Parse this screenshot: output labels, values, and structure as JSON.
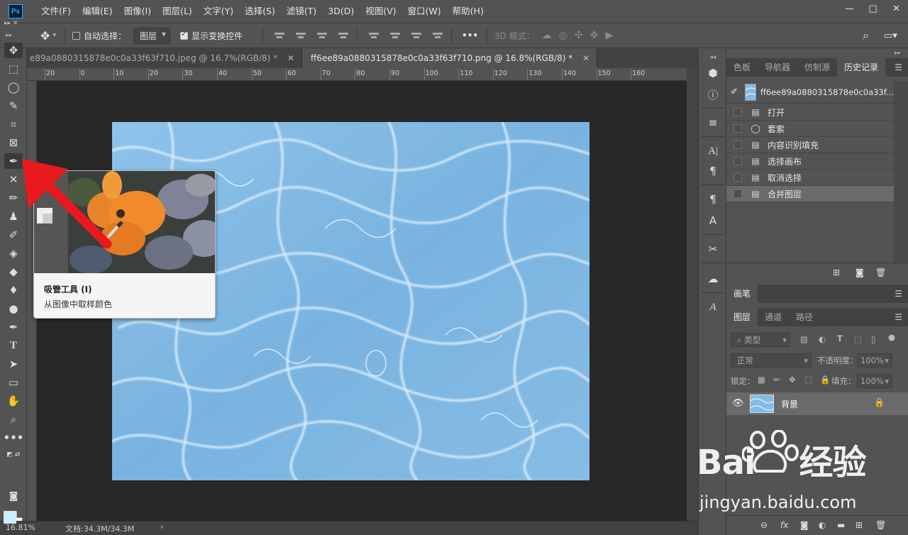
{
  "app": {
    "logo": "Ps"
  },
  "menu": [
    "文件(F)",
    "编辑(E)",
    "图像(I)",
    "图层(L)",
    "文字(Y)",
    "选择(S)",
    "滤镜(T)",
    "3D(D)",
    "视图(V)",
    "窗口(W)",
    "帮助(H)"
  ],
  "window_controls": {
    "minimize": "—",
    "restore": "□",
    "close": "✕"
  },
  "options": {
    "auto_select_label": "自动选择：",
    "auto_select_value": "图层",
    "show_transform_label": "显示变换控件",
    "more": "•••",
    "mode_3d_label": "3D 模式："
  },
  "tabs": [
    {
      "label": "e89a0880315878e0c0a33f63f710.jpeg @ 16.7%(RGB/8) *",
      "close": "✕"
    },
    {
      "label": "ff6ee89a0880315878e0c0a33f63f710.png @ 16.8%(RGB/8) *",
      "close": "✕"
    }
  ],
  "ruler_top": [
    "20",
    "0",
    "10",
    "20",
    "30",
    "40",
    "50",
    "60",
    "70",
    "80",
    "90",
    "100",
    "110",
    "120",
    "130",
    "140",
    "150",
    "160"
  ],
  "tooltip": {
    "title": "吸管工具 (I)",
    "description": "从图像中取样颜色"
  },
  "status": {
    "zoom": "16.81%",
    "doc": "文档:34.3M/34.3M",
    "arrow": "›"
  },
  "history_panel": {
    "tabs": [
      "色板",
      "导航器",
      "仿制源",
      "历史记录"
    ],
    "doc_name": "ff6ee89a0880315878e0c0a33f...",
    "steps": [
      "打开",
      "套索",
      "内容识别填充",
      "选择画布",
      "取消选择",
      "合并图层"
    ],
    "current_index": 5
  },
  "brush_panel": {
    "tab": "画笔"
  },
  "layers_panel": {
    "tabs": [
      "图层",
      "通道",
      "路径"
    ],
    "filter_label": "类型",
    "blend_mode": "正常",
    "opacity_label": "不透明度：",
    "opacity": "100%",
    "lock_label": "锁定：",
    "fill_label": "填充：",
    "fill": "100%",
    "layer_name": "背景"
  },
  "watermark": {
    "brand": "Bai du 经验",
    "url": "jingyan.baidu.com"
  },
  "colors": {
    "foreground": "#c9f0ff",
    "background": "#ffffff",
    "arrow": "#e8191c",
    "canvas_bg": "#282828",
    "panel_bg": "#535353"
  }
}
